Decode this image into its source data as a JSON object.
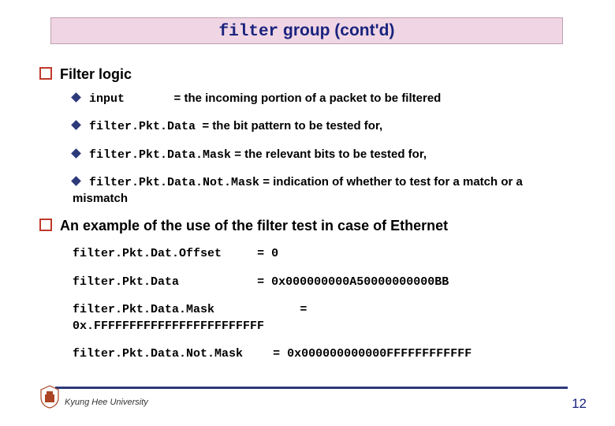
{
  "title_mono": "filter",
  "title_rest": " group (cont'd)",
  "sec1": "Filter logic",
  "items": [
    {
      "term": "input",
      "desc": " = the incoming portion of a packet to be filtered"
    },
    {
      "term": "filter.Pkt.Data",
      "desc": " = the bit pattern to be tested for,"
    },
    {
      "term": "filter.Pkt.Data.Mask",
      "desc": " = the relevant bits to be tested for,"
    },
    {
      "term": "filter.Pkt.Data.Not.Mask",
      "desc": " = indication of whether to test for a match or a mismatch"
    }
  ],
  "sec2": "An example of the use of the filter test in case of Ethernet",
  "example": [
    {
      "key": "filter.Pkt.Dat.Offset",
      "val": "= 0"
    },
    {
      "key": "filter.Pkt.Data",
      "val": "= 0x000000000A50000000000BB"
    },
    {
      "key": "filter.Pkt.Data.Mask",
      "val2a": "=",
      "val2b": "0x.FFFFFFFFFFFFFFFFFFFFFFFF"
    },
    {
      "key": "filter.Pkt.Data.Not.Mask",
      "val": "= 0x000000000000FFFFFFFFFFFF"
    }
  ],
  "university": "Kyung Hee University",
  "page": "12"
}
